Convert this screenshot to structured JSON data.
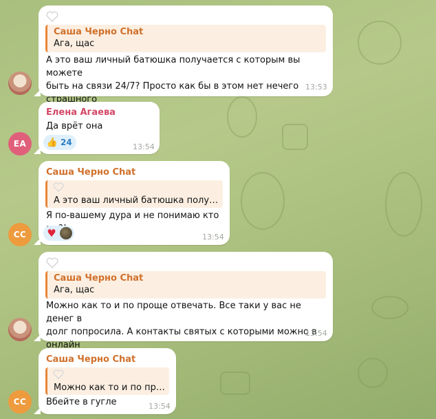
{
  "messages": [
    {
      "reply_name": "Саша Черно Chat",
      "reply_text": "Ага, щас",
      "text": "А это ваш личный батюшка получается с которым вы можете\nбыть на связи 24/7? Просто как бы в этом нет нечего страшного\nдать контакт .",
      "time": "13:53"
    },
    {
      "sender": "Елена Агаева",
      "sender_color": "#d44867",
      "avatar_initials": "EA",
      "text": "Да врёт она",
      "reaction_emoji": "👍",
      "reaction_count": "24",
      "time": "13:54"
    },
    {
      "sender": "Саша Черно Chat",
      "sender_color": "#d0702b",
      "avatar_initials": "CC",
      "reply_text": "А это ваш личный батюшка получае...",
      "text": "Я по-вашему дура и не понимаю кто вы?!",
      "reaction_emoji": "♥",
      "time": "13:54"
    },
    {
      "reply_name": "Саша Черно Chat",
      "reply_text": "Ага, щас",
      "text": "Можно как то и по проще отвечать. Все таки у вас не денег в\nдолг попросила. А контакты святых с которыми можно в онлайн\nсвязи общаться.",
      "time": "13:54"
    },
    {
      "sender": "Саша Черно Chat",
      "sender_color": "#d0702b",
      "avatar_initials": "CC",
      "reply_text": "Можно как то и по про...",
      "text": "Вбейте в гугле",
      "time": "13:54"
    }
  ],
  "colors": {
    "accent": "#d0702b",
    "bubble": "#ffffff",
    "reply_bg": "#fcefe2",
    "reaction_bg": "#dff0fb"
  }
}
